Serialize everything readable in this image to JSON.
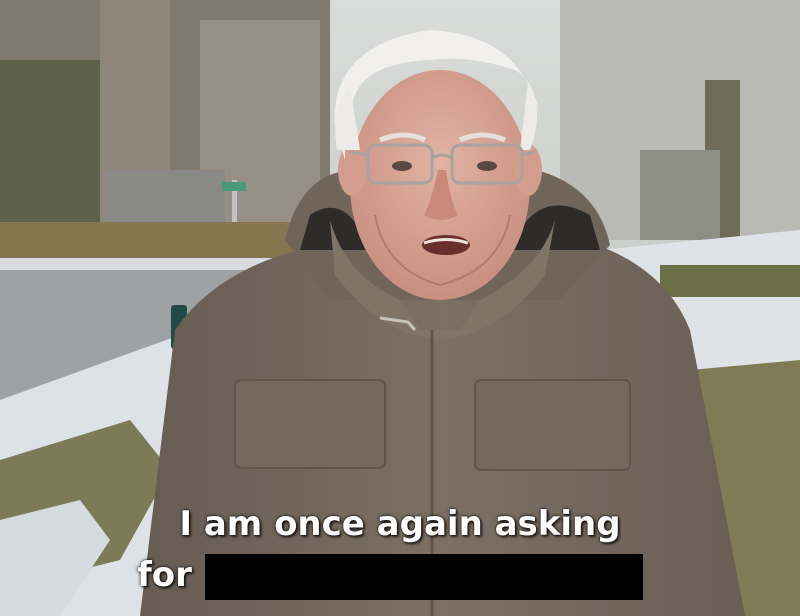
{
  "caption": {
    "line1": "I am once again asking",
    "line2": "for"
  },
  "colors": {
    "sky": "#d8dbd8",
    "snow": "#e4e8ec",
    "grass": "#7f7f57",
    "road": "#9a9d9c",
    "coat": "#776b5f",
    "skin": "#d9a898",
    "hair": "#f0efee",
    "redaction": "#000000",
    "caption_text": "#ffffff"
  }
}
